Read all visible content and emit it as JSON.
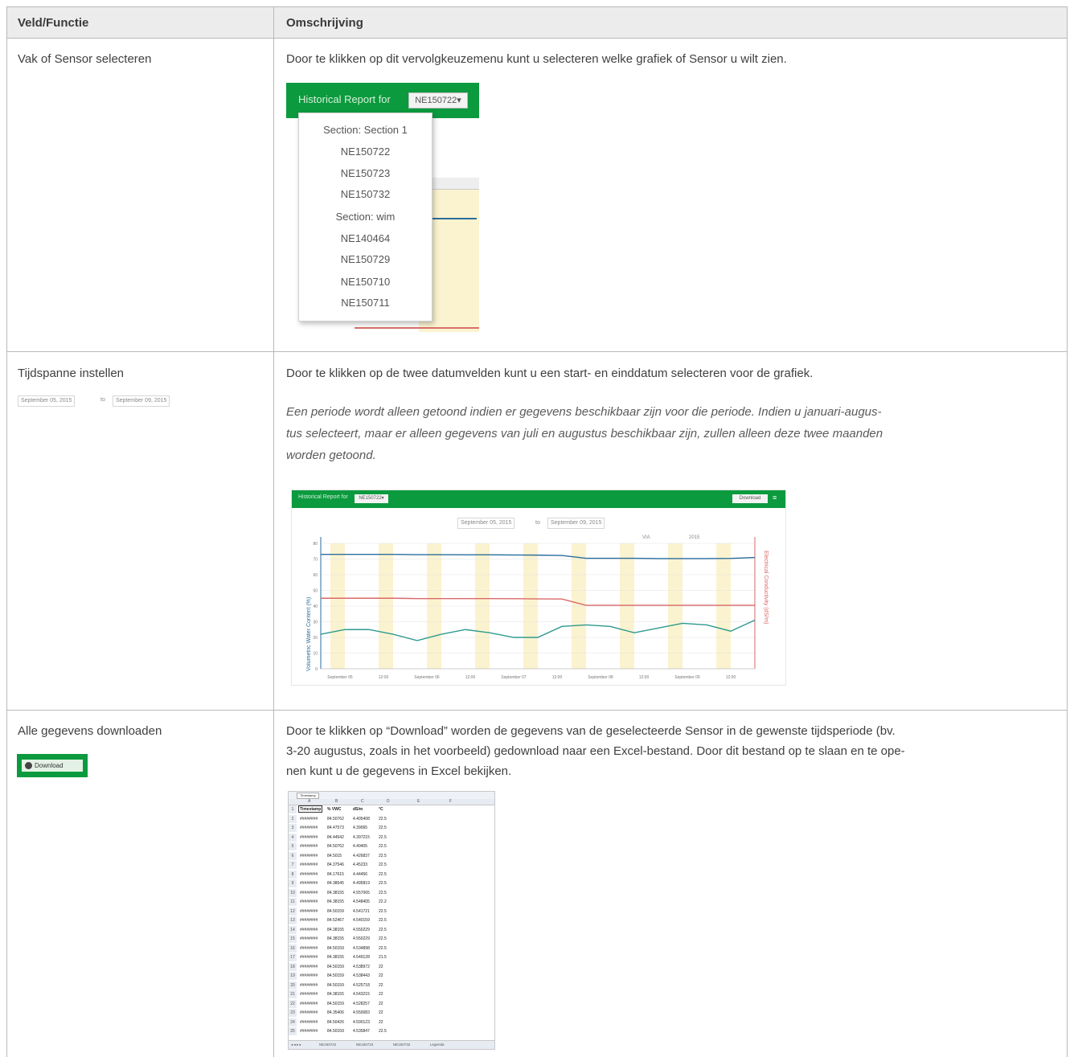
{
  "table": {
    "headers": {
      "col1": "Veld/Functie",
      "col2": "Omschrijving"
    },
    "rows": [
      {
        "field": "Vak of Sensor selecteren",
        "description": "Door te klikken op dit vervolgkeuzemenu kunt u selecteren welke grafiek of Sensor u wilt zien."
      },
      {
        "field": "Tijdspanne instellen",
        "description": "Door te klikken op de twee datumvelden kunt u een start- en einddatum selecteren voor de grafiek.",
        "note_lines": [
          "Een periode wordt alleen getoond indien er gegevens beschikbaar zijn voor die periode. Indien u januari-augus-",
          "tus selecteert, maar er alleen gegevens van juli en augustus beschikbaar zijn, zullen alleen deze twee maanden",
          "worden getoond."
        ]
      },
      {
        "field": "Alle gegevens downloaden",
        "description_lines": [
          "Door te klikken op “Download” worden de gegevens van de geselecteerde Sensor in de gewenste tijdsperiode (bv.",
          "3-20 augustus, zoals in het voorbeeld) gedownload naar een Excel-bestand. Door dit bestand op te slaan en te ope-",
          "nen kunt u de gegevens in Excel bekijken."
        ]
      }
    ]
  },
  "dropdown_shot": {
    "title": "Historical Report for",
    "selected": "NE150722▾",
    "items": [
      "Section: Section 1",
      "NE150722",
      "NE150723",
      "NE150732",
      "Section: wim",
      "NE140464",
      "NE150729",
      "NE150710",
      "NE150711"
    ]
  },
  "date_picker": {
    "start": "September 05, 2015",
    "to": "to",
    "end": "September 09, 2015"
  },
  "chart_shot": {
    "title": "Historical Report for",
    "selected": "NE150722▾",
    "download": "Download",
    "menu": "≡",
    "start": "September 05, 2015",
    "to": "to",
    "end": "September 09, 2015",
    "stats": [
      "VIA",
      "2015"
    ],
    "ylabel_left": "Volumetric Water Content (%)",
    "ylabel_right": "Electrical Conductivity (dS/m)",
    "xticks": [
      "September 05",
      "12:00",
      "September 06",
      "12:00",
      "September 07",
      "12:00",
      "September 08",
      "12:00",
      "September 09",
      "12:00"
    ],
    "yticks": [
      "80",
      "70",
      "60",
      "50",
      "40",
      "30",
      "20",
      "10",
      "0"
    ]
  },
  "chart_data": {
    "type": "line",
    "title": "Historical Report for",
    "xlabel": "",
    "ylabel": "Volumetric Water Content (%)",
    "ylabel_right": "Electrical Conductivity (dS/m)",
    "x": [
      0,
      0.5,
      1,
      1.5,
      2,
      2.5,
      3,
      3.5,
      4,
      4.5,
      5,
      5.5,
      6,
      6.5,
      7,
      7.5,
      8,
      8.5,
      9
    ],
    "series": [
      {
        "name": "",
        "color": "#2a6d9c",
        "values": [
          73,
          73,
          73,
          73,
          72.8,
          72.8,
          72.7,
          72.7,
          72.6,
          72.5,
          72.3,
          70.5,
          70.5,
          70.5,
          70.3,
          70.3,
          70.3,
          70.4,
          71
        ]
      },
      {
        "name": "",
        "color": "#d86a68",
        "values": [
          45,
          45,
          45,
          45,
          44.8,
          44.8,
          44.8,
          44.8,
          44.7,
          44.6,
          44.5,
          40.5,
          40.5,
          40.5,
          40.5,
          40.5,
          40.5,
          40.5,
          40.5
        ]
      },
      {
        "name": "",
        "color": "#2e9a8f",
        "values": [
          22,
          25,
          25,
          22,
          18,
          22,
          25,
          23,
          20,
          20,
          27,
          28,
          27,
          23,
          26,
          29,
          28,
          24,
          31
        ]
      }
    ],
    "ylim": [
      0,
      80
    ],
    "grid": true
  },
  "download_button": {
    "label": "Download"
  },
  "excel_shot": {
    "namebox": "Timestamp",
    "col_letters": [
      "A",
      "B",
      "C",
      "D",
      "E",
      "F"
    ],
    "headers": [
      "Timestamp",
      "% VWC",
      "dS/m",
      "°C"
    ],
    "rows": [
      [
        "########",
        "84.50762",
        "4.405408",
        "22.5"
      ],
      [
        "########",
        "84.47573",
        "4.39065",
        "22.5"
      ],
      [
        "########",
        "84.44542",
        "4.397215",
        "22.5"
      ],
      [
        "########",
        "84.50762",
        "4.40405",
        "22.5"
      ],
      [
        "########",
        "84.5015",
        "4.426837",
        "22.5"
      ],
      [
        "########",
        "84.37546",
        "4.45233",
        "22.5"
      ],
      [
        "########",
        "84.17615",
        "4.44456",
        "22.5"
      ],
      [
        "########",
        "84.38045",
        "4.495819",
        "22.5"
      ],
      [
        "########",
        "84.38155",
        "4.557065",
        "22.5"
      ],
      [
        "########",
        "84.38155",
        "4.548405",
        "22.2"
      ],
      [
        "########",
        "84.50159",
        "4.541721",
        "22.5"
      ],
      [
        "########",
        "84.52467",
        "4.540159",
        "22.5"
      ],
      [
        "########",
        "84.38155",
        "4.550229",
        "22.5"
      ],
      [
        "########",
        "84.38155",
        "4.550229",
        "22.5"
      ],
      [
        "########",
        "84.50159",
        "4.534898",
        "22.5"
      ],
      [
        "########",
        "84.38155",
        "4.549128",
        "21.5"
      ],
      [
        "########",
        "84.50159",
        "4.538972",
        "22"
      ],
      [
        "########",
        "84.50159",
        "4.538443",
        "22"
      ],
      [
        "########",
        "84.50159",
        "4.525718",
        "22"
      ],
      [
        "########",
        "84.38155",
        "4.543215",
        "22"
      ],
      [
        "########",
        "84.50159",
        "4.528257",
        "22"
      ],
      [
        "########",
        "84.35406",
        "4.550083",
        "22"
      ],
      [
        "########",
        "84.50426",
        "4.590123",
        "22"
      ],
      [
        "########",
        "84.50159",
        "4.535847",
        "22.5"
      ]
    ],
    "sheets": [
      "NE150722",
      "NE150723",
      "NE150732",
      "Legenda"
    ]
  }
}
